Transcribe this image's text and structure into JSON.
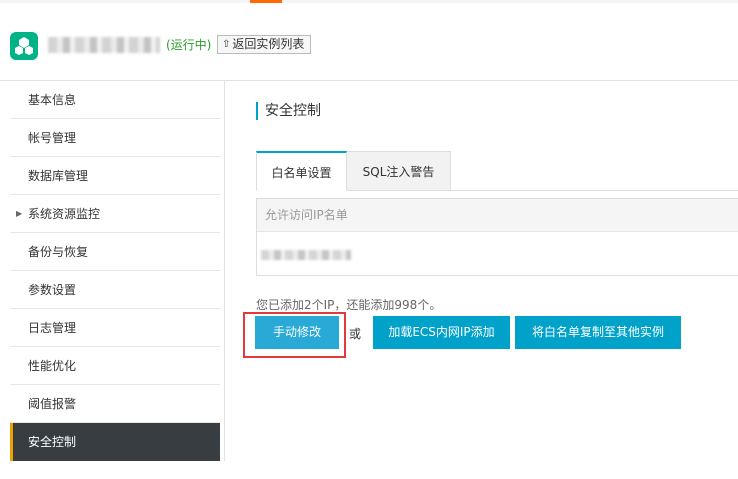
{
  "header": {
    "status": "(运行中)",
    "back_button": "返回实例列表",
    "icon": "app-logo-icon"
  },
  "sidebar": {
    "items": [
      {
        "label": "基本信息"
      },
      {
        "label": "帐号管理"
      },
      {
        "label": "数据库管理"
      },
      {
        "label": "系统资源监控",
        "expandable": true
      },
      {
        "label": "备份与恢复"
      },
      {
        "label": "参数设置"
      },
      {
        "label": "日志管理"
      },
      {
        "label": "性能优化"
      },
      {
        "label": "阈值报警"
      },
      {
        "label": "安全控制",
        "active": true
      }
    ]
  },
  "main": {
    "title": "安全控制",
    "tabs": [
      {
        "label": "白名单设置",
        "active": true
      },
      {
        "label": "SQL注入警告",
        "active": false
      }
    ],
    "table": {
      "header": "允许访问IP名单"
    },
    "count_text": "您已添加2个IP，还能添加998个。",
    "buttons": {
      "manual": "手动修改",
      "or": "或",
      "ecs": "加载ECS内网IP添加",
      "copy": "将白名单复制至其他实例"
    }
  },
  "colors": {
    "accent": "#00a2ca",
    "sidebar_active_bg": "#373d41",
    "status_green": "#2a9d2a",
    "highlight_red": "#e23a3a",
    "top_accent": "#ff6a00"
  }
}
